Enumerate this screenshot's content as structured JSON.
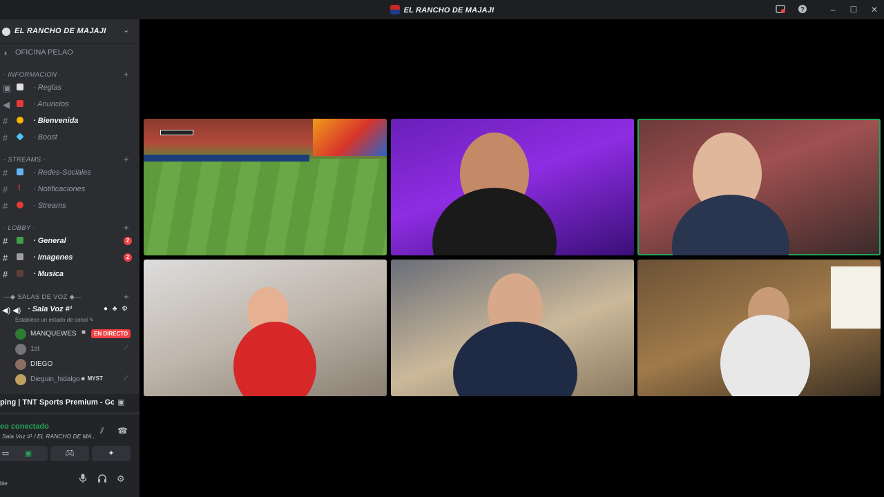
{
  "window": {
    "title": "EL RANCHO DE MAJAJI"
  },
  "server": {
    "name": "EL RANCHO DE MAJAJI",
    "top_channel": "OFICINA PELAO"
  },
  "categories": [
    {
      "name": "· INFORMACION ·",
      "channels": [
        {
          "label": "· Reglas",
          "emoji_color": "#e0e0e0"
        },
        {
          "label": "· Anuncios",
          "emoji_color": "#e53935"
        },
        {
          "label": "· Bienvenida",
          "emoji_color": "#f4b400",
          "bright": true
        },
        {
          "label": "· Boost",
          "emoji_color": "#4fc3f7"
        }
      ]
    },
    {
      "name": "· STREAMS ·",
      "channels": [
        {
          "label": "· Redes-Sociales",
          "emoji_color": "#64b5f6"
        },
        {
          "label": "· Notificaciones",
          "emoji_color": "#e53935"
        },
        {
          "label": "· Streams",
          "emoji_color": "#e53935"
        }
      ]
    },
    {
      "name": "· LOBBY ·",
      "channels": [
        {
          "label": "· General",
          "emoji_color": "#43a047",
          "bright": true,
          "badge": "2"
        },
        {
          "label": "· Imagenes",
          "emoji_color": "#9e9e9e",
          "bright": true,
          "badge": "2"
        },
        {
          "label": "· Musica",
          "emoji_color": "#5d4037",
          "bright": true
        }
      ]
    }
  ],
  "voice_category": "SALAS DE VOZ",
  "voice_channel": {
    "name": "· Sala Voz #¹",
    "status_placeholder": "Establece un estado de canal"
  },
  "members": [
    {
      "name": "MANQUEWES",
      "avatar_color": "#2e7d32",
      "live_label": "EN DIRECTO"
    },
    {
      "name": "1st",
      "avatar_color": "#757575",
      "dim": true
    },
    {
      "name": "DIEGO",
      "avatar_color": "#8d6e63"
    },
    {
      "name": "Dieguin_hidalgo",
      "avatar_color": "#c0a060",
      "dim": true,
      "tag": "MYST"
    }
  ],
  "activity": {
    "text": "ping | TNT Sports Premium - Go..."
  },
  "voice_panel": {
    "status": "eo conectado",
    "channel": "Sala Voz #¹ / EL RANCHO DE MA..."
  },
  "user_panel": {
    "status": "ble"
  },
  "icons": {
    "settings": "gear-icon",
    "help": "help-icon",
    "inbox": "inbox-icon",
    "mic": "microphone-icon",
    "headphones": "headphones-icon"
  },
  "colors": {
    "sidebar": "#2b2d31",
    "accent_green": "#23a55a",
    "badge_red": "#f23f43"
  }
}
